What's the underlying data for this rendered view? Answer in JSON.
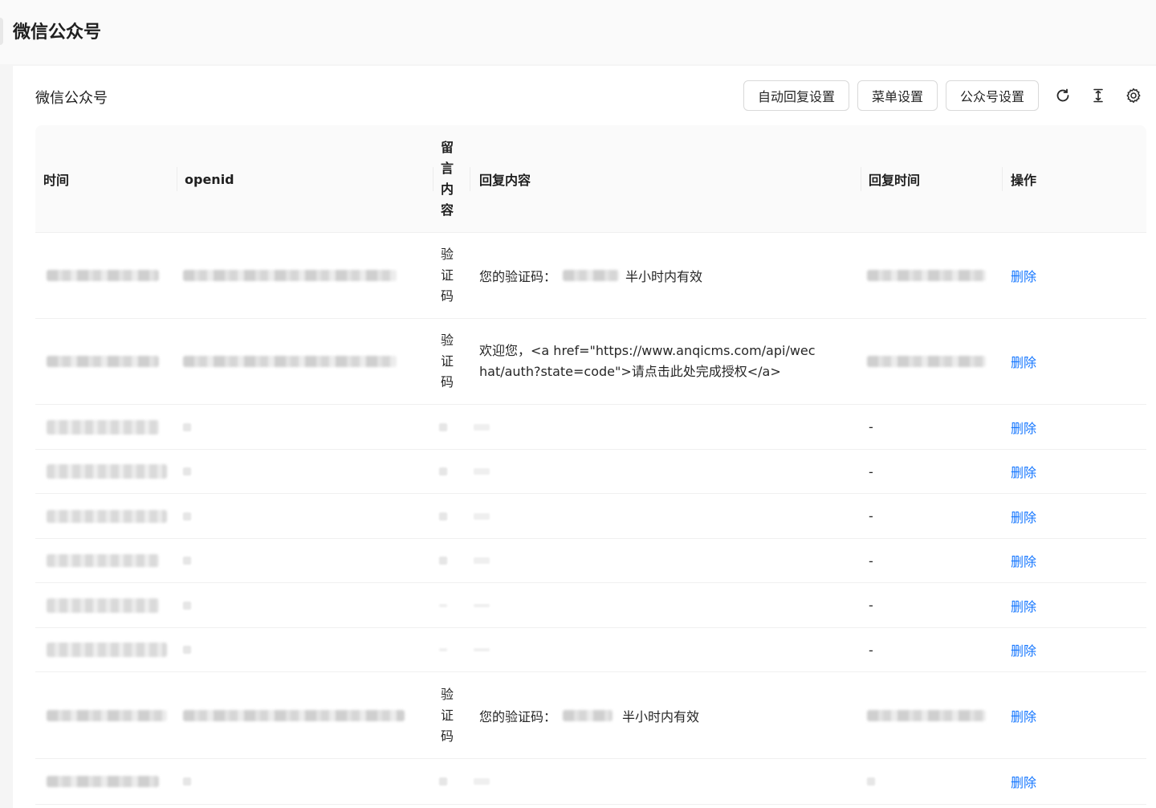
{
  "page": {
    "title": "微信公众号"
  },
  "card": {
    "title": "微信公众号"
  },
  "toolbar": {
    "auto_reply_label": "自动回复设置",
    "menu_label": "菜单设置",
    "account_label": "公众号设置",
    "icons": [
      "reload-icon",
      "column-height-icon",
      "setting-icon"
    ]
  },
  "table": {
    "columns": {
      "time": "时间",
      "openid": "openid",
      "content": "留言内容",
      "reply": "回复内容",
      "reply_time": "回复时间",
      "action": "操作"
    },
    "rows": [
      {
        "content": "验证码",
        "reply_prefix": "您的验证码：",
        "reply_suffix": "半小时内有效",
        "reply_time_text": "",
        "action": "删除"
      },
      {
        "content": "验证码",
        "reply_full": "欢迎您，<a href=\"https://www.anqicms.com/api/wechat/auth?state=code\">请点击此处完成授权</a>",
        "reply_time_text": "",
        "action": "删除"
      },
      {
        "content": "",
        "reply_time_text": "-",
        "action": "删除"
      },
      {
        "content": "",
        "reply_time_text": "-",
        "action": "删除"
      },
      {
        "content": "",
        "reply_time_text": "-",
        "action": "删除"
      },
      {
        "content": "",
        "reply_time_text": "-",
        "action": "删除"
      },
      {
        "content": "",
        "reply_time_text": "-",
        "action": "删除"
      },
      {
        "content": "",
        "reply_time_text": "-",
        "action": "删除"
      },
      {
        "content": "验证码",
        "reply_prefix": "您的验证码：",
        "reply_suffix": "半小时内有效",
        "reply_time_text": "",
        "action": "删除"
      },
      {
        "content": "",
        "reply_time_text": "",
        "action": "删除"
      }
    ]
  },
  "colors": {
    "link": "#1677ff",
    "header_bg": "#fafafa",
    "border": "#f0f0f0"
  }
}
